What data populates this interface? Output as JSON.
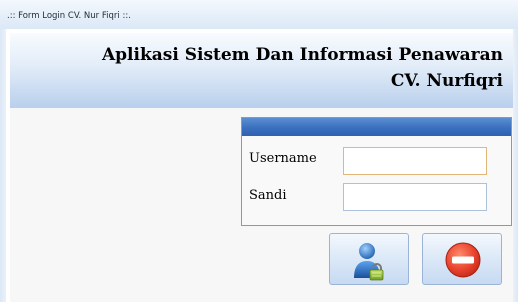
{
  "window": {
    "title": ".:: Form Login CV. Nur Fiqri ::."
  },
  "header": {
    "title_line1": "Aplikasi Sistem Dan Informasi Penawaran",
    "title_line2": "CV. Nurfiqri"
  },
  "login_form": {
    "username_label": "Username",
    "username_value": "",
    "password_label": "Sandi",
    "password_value": ""
  },
  "buttons": {
    "login_icon": "user-lock-icon",
    "cancel_icon": "no-entry-icon"
  },
  "colors": {
    "panel_header": "#3a70be",
    "focus_border": "#e3b77a",
    "cancel_red": "#e8422c"
  }
}
